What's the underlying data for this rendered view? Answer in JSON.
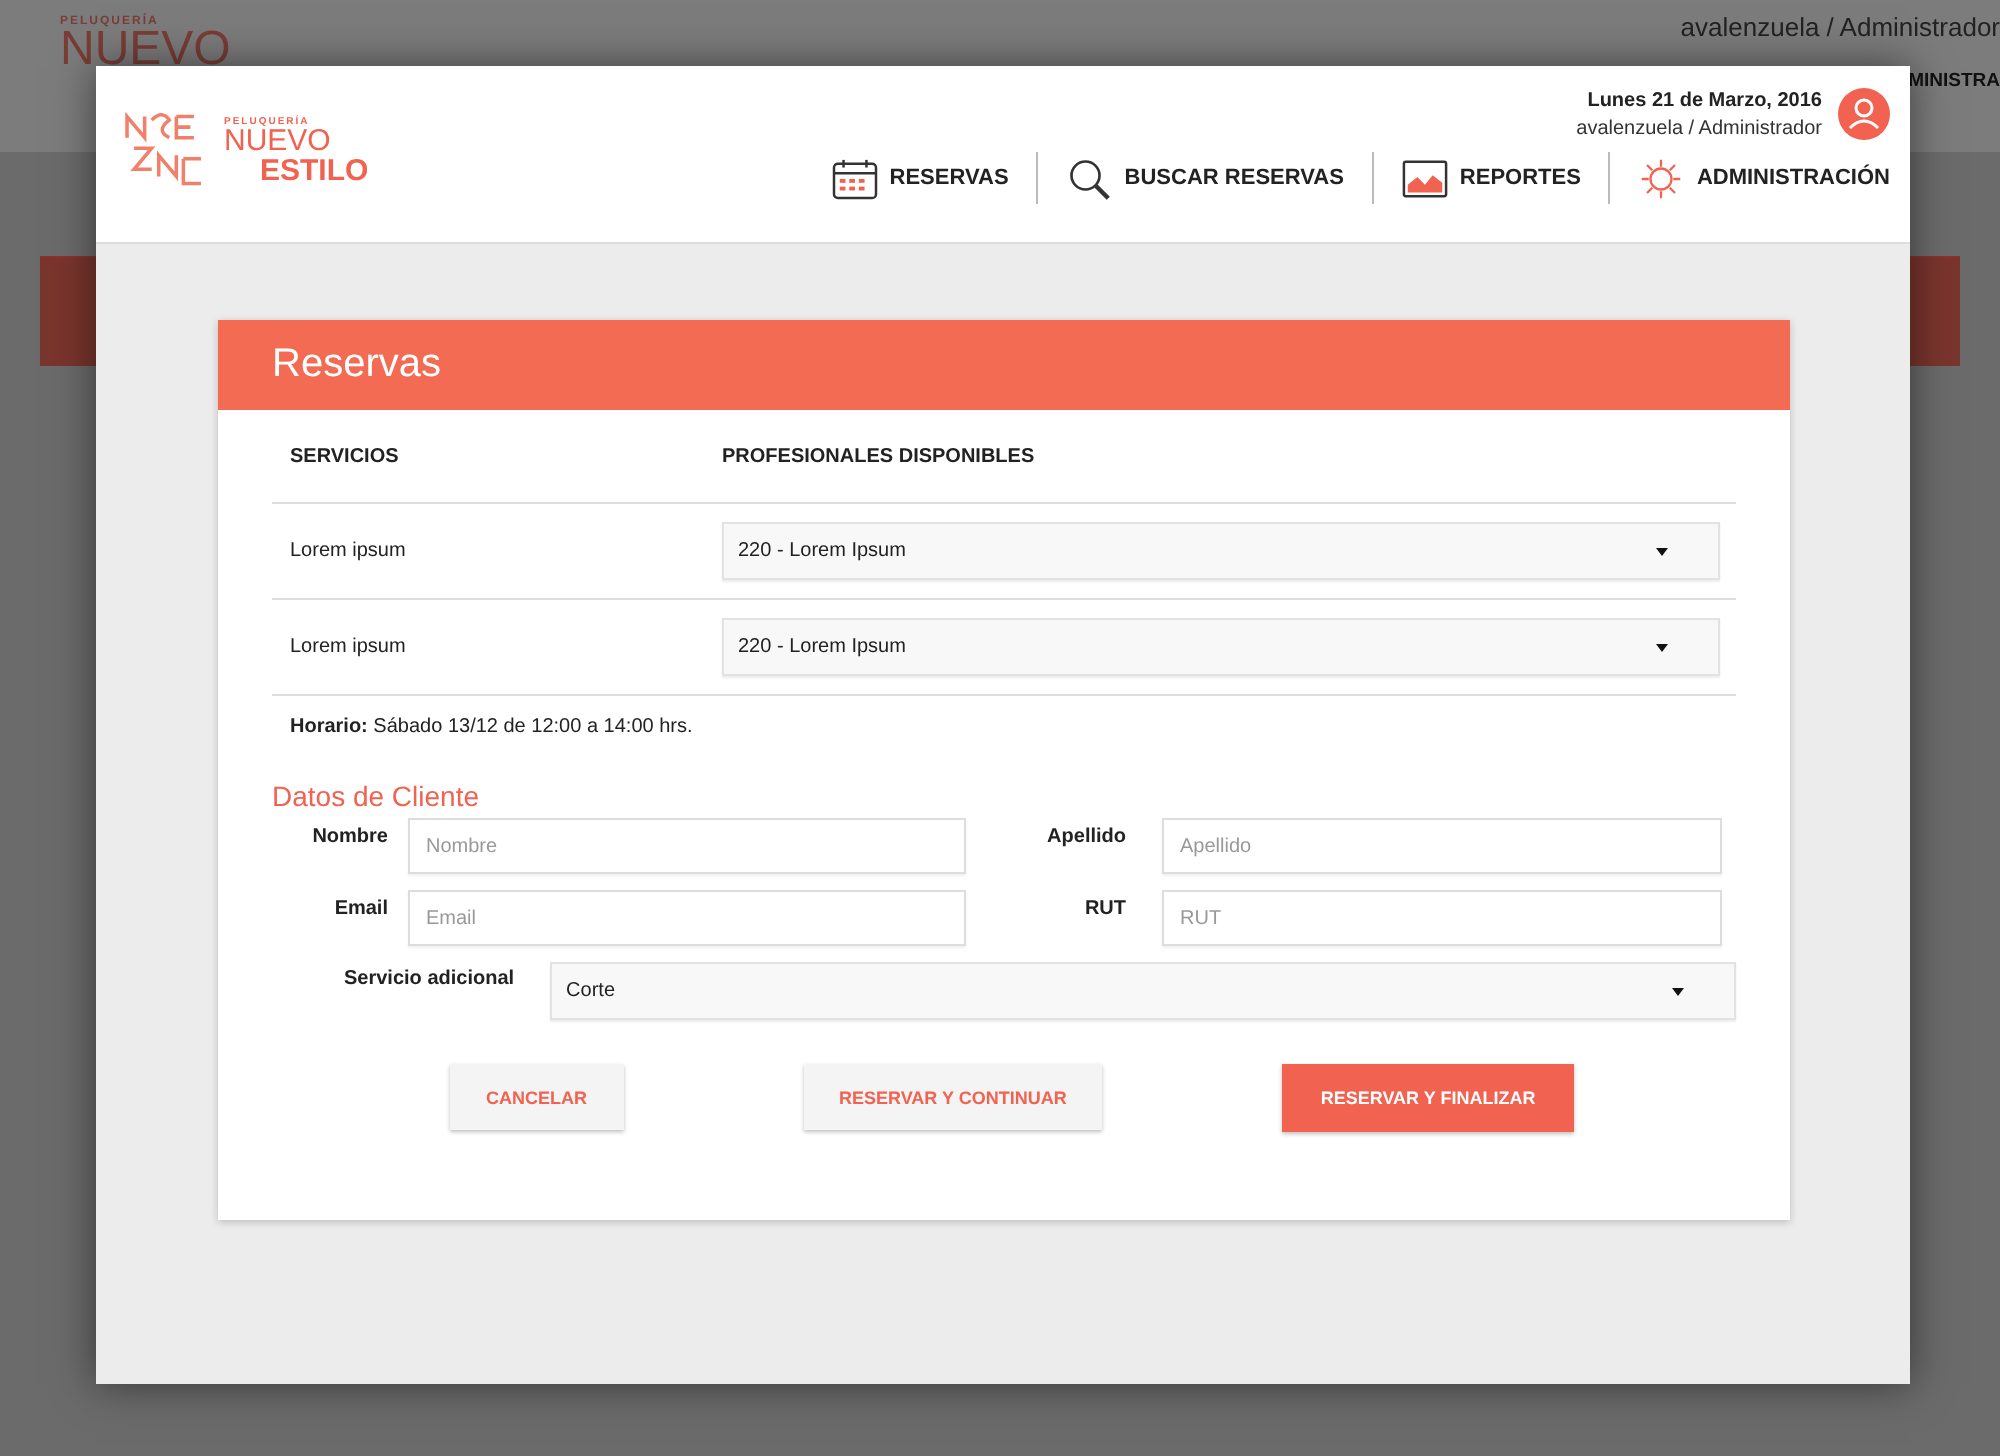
{
  "background": {
    "brand": {
      "small": "PELUQUERÍA",
      "name": "NUEVO"
    },
    "user": "avalenzuela / Administrador",
    "nav_item": "MINISTRA"
  },
  "header": {
    "brand": {
      "small": "PELUQUERÍA",
      "line1": "NUEVO",
      "line2": "ESTILO"
    },
    "date": "Lunes 21 de Marzo, 2016",
    "user": "avalenzuela / Administrador",
    "nav": [
      {
        "label": "RESERVAS"
      },
      {
        "label": "BUSCAR RESERVAS"
      },
      {
        "label": "REPORTES"
      },
      {
        "label": "ADMINISTRACIÓN"
      }
    ]
  },
  "card": {
    "title": "Reservas",
    "columns": [
      "SERVICIOS",
      "PROFESIONALES DISPONIBLES"
    ],
    "rows": [
      {
        "service": "Lorem ipsum",
        "professional": "220 - Lorem Ipsum"
      },
      {
        "service": "Lorem ipsum",
        "professional": "220 - Lorem Ipsum"
      }
    ],
    "schedule": "**Horario:** Sábado 13/12 de 12:00 a 14:00 hrs.",
    "client": {
      "title": "Datos de Cliente",
      "fields": [
        {
          "label": "Nombre",
          "placeholder": "Nombre"
        },
        {
          "label": "Apellido",
          "placeholder": "Apellido"
        },
        {
          "label": "Email",
          "placeholder": "Email"
        },
        {
          "label": "RUT",
          "placeholder": "RUT"
        }
      ],
      "extra": {
        "label": "Servicio adicional",
        "value": "Corte"
      }
    },
    "buttons": [
      {
        "label": "CANCELAR",
        "kind": "secondary"
      },
      {
        "label": "RESERVAR Y CONTINUAR",
        "kind": "secondary"
      },
      {
        "label": "RESERVAR Y FINALIZAR",
        "kind": "primary"
      }
    ]
  }
}
